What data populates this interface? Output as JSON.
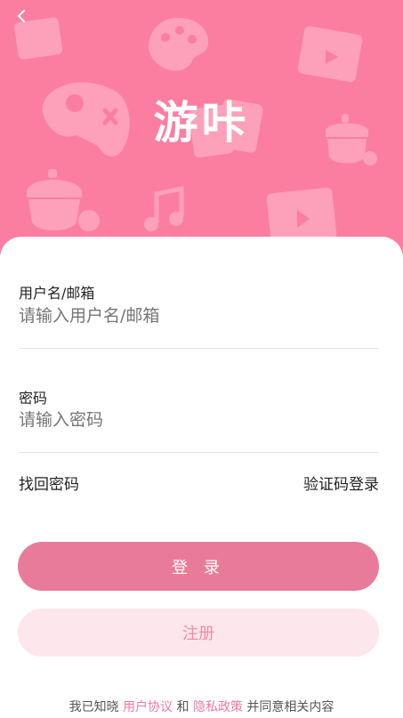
{
  "header": {
    "app_title": "游咔",
    "back_icon": "chevron-left-icon"
  },
  "form": {
    "username_label": "用户名/邮箱",
    "username_placeholder": "请输入用户名/邮箱",
    "password_label": "密码",
    "password_placeholder": "请输入密码"
  },
  "links": {
    "forgot_password": "找回密码",
    "code_login": "验证码登录"
  },
  "buttons": {
    "login": "登 录",
    "register": "注册"
  },
  "terms": {
    "prefix": "我已知晓",
    "user_agreement": "用户协议",
    "and": "和",
    "privacy_policy": "隐私政策",
    "suffix": "并同意相关内容"
  },
  "colors": {
    "hero_bg": "#fb7ea0",
    "login_bg": "#e97b9a",
    "register_bg": "#fde6ec",
    "link_pink": "#f07aa0"
  }
}
